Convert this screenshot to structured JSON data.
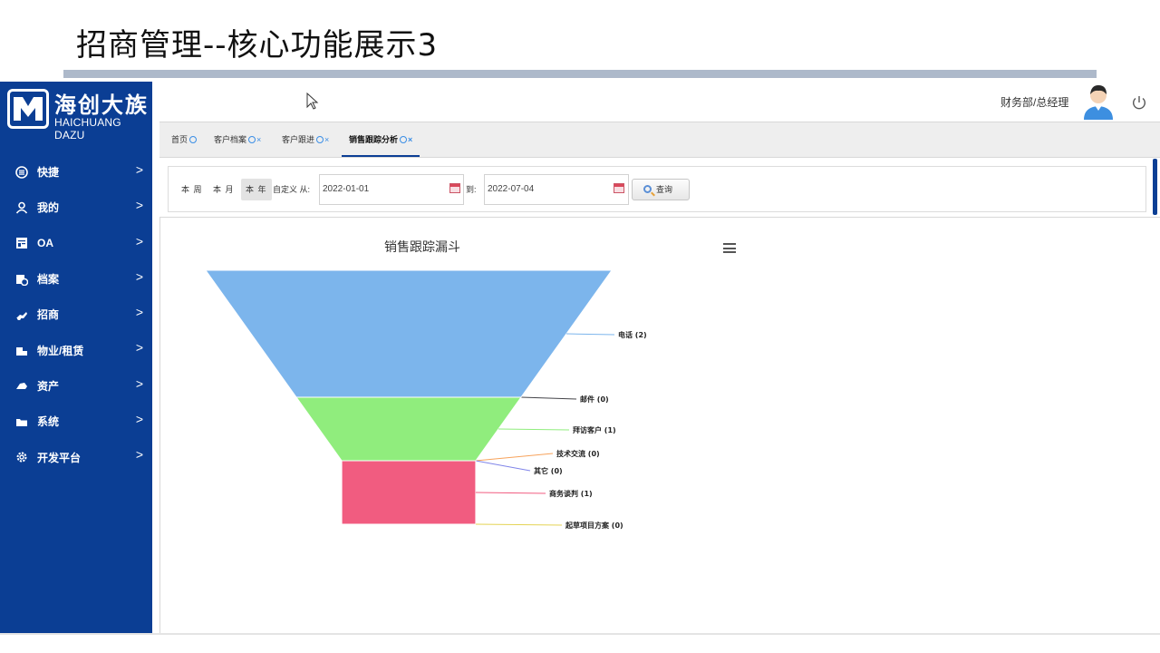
{
  "slide": {
    "title": "招商管理--核心功能展示3"
  },
  "logo": {
    "name_cn": "海创大族",
    "name_en": "HAICHUANG DAZU"
  },
  "sidebar": {
    "items": [
      {
        "label": "快捷",
        "icon": "list-circle-icon"
      },
      {
        "label": "我的",
        "icon": "user-icon"
      },
      {
        "label": "OA",
        "icon": "document-icon"
      },
      {
        "label": "档案",
        "icon": "archive-icon"
      },
      {
        "label": "招商",
        "icon": "handshake-icon"
      },
      {
        "label": "物业/租赁",
        "icon": "building-icon"
      },
      {
        "label": "资产",
        "icon": "cloud-icon"
      },
      {
        "label": "系统",
        "icon": "folder-icon"
      },
      {
        "label": "开发平台",
        "icon": "gear-icon"
      }
    ],
    "arrow": ">"
  },
  "header": {
    "user_label": "财务部/总经理"
  },
  "tabs": [
    {
      "label": "首页"
    },
    {
      "label": "客户档案"
    },
    {
      "label": "客户跟进"
    },
    {
      "label": "销售跟踪分析"
    }
  ],
  "filter": {
    "this_week": "本 周",
    "this_month": "本 月",
    "this_year": "本 年",
    "custom_from": "自定义 从:",
    "to": "到:",
    "date_from": "2022-01-01",
    "date_to": "2022-07-04",
    "query": "查询"
  },
  "colors": {
    "sidebar": "#0b3e94",
    "accent": "#3a8ee6"
  },
  "chart_data": {
    "type": "funnel",
    "title": "销售跟踪漏斗",
    "stages": [
      {
        "name": "电话",
        "value": 2,
        "label": "电话 (2)",
        "color": "#7cb5ec"
      },
      {
        "name": "邮件",
        "value": 0,
        "label": "邮件 (0)",
        "color": "#434348"
      },
      {
        "name": "拜访客户",
        "value": 1,
        "label": "拜访客户 (1)",
        "color": "#90ed7d"
      },
      {
        "name": "技术交流",
        "value": 0,
        "label": "技术交流 (0)",
        "color": "#f7a35c"
      },
      {
        "name": "其它",
        "value": 0,
        "label": "其它 (0)",
        "color": "#8085e9"
      },
      {
        "name": "商务谈判",
        "value": 1,
        "label": "商务谈判 (1)",
        "color": "#f15c80"
      },
      {
        "name": "起草项目方案",
        "value": 0,
        "label": "起草项目方案 (0)",
        "color": "#e4d354"
      }
    ],
    "neck_height_fraction": 0.25,
    "neck_width_fraction": 0.33,
    "legend": "none"
  }
}
